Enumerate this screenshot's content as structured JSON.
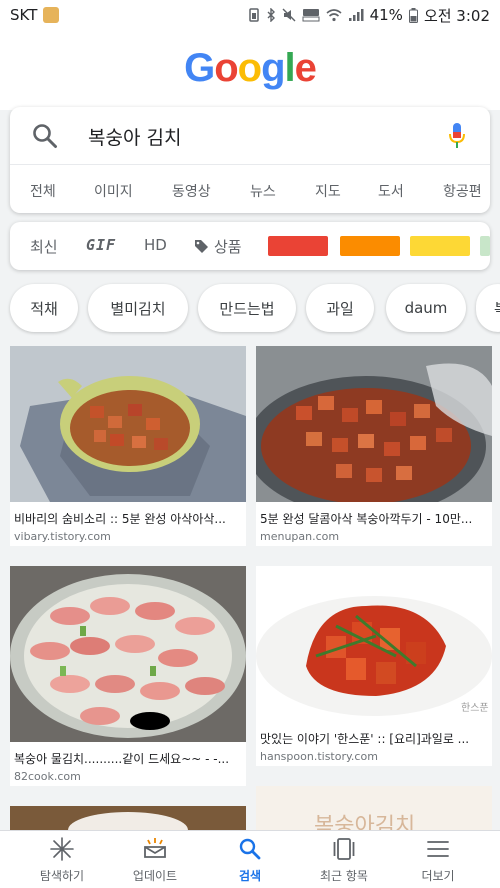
{
  "status_bar": {
    "carrier": "SKT",
    "battery": "41%",
    "time": "오전 3:02"
  },
  "logo": {
    "letters": [
      "G",
      "o",
      "o",
      "g",
      "l",
      "e"
    ]
  },
  "search": {
    "query": "복숭아 김치",
    "search_icon": "search-icon",
    "mic_icon": "mic-icon"
  },
  "tabs": [
    "전체",
    "이미지",
    "동영상",
    "뉴스",
    "지도",
    "도서",
    "항공편"
  ],
  "filters": {
    "recent": "최신",
    "gif": "GIF",
    "hd": "HD",
    "products": "상품",
    "colors": [
      "#ea4335",
      "#fb8c00",
      "#fdd835",
      "#c8e6c9"
    ]
  },
  "chips": [
    "적채",
    "별미김치",
    "만드는법",
    "과일",
    "daum",
    "복"
  ],
  "results": [
    {
      "title": "비바리의 숨비소리 :: 5분 완성 아삭아삭...",
      "domain": "vibary.tistory.com"
    },
    {
      "title": "5분 완성 달콤아삭 복숭아깍두기 - 10만...",
      "domain": "menupan.com"
    },
    {
      "title": "복숭아 물김치..........같이 드세요~~ - -...",
      "domain": "82cook.com"
    },
    {
      "title": "맛있는 이야기 '한스푼' :: [요리]과일로 ...",
      "domain": "hanspoon.tistory.com"
    }
  ],
  "partial_result_text": "복숭아김치",
  "bottom_nav": [
    {
      "label": "탐색하기",
      "icon": "sparkle-icon"
    },
    {
      "label": "업데이트",
      "icon": "updates-icon"
    },
    {
      "label": "검색",
      "icon": "search-icon"
    },
    {
      "label": "최근 항목",
      "icon": "recent-items-icon"
    },
    {
      "label": "더보기",
      "icon": "menu-icon"
    }
  ]
}
